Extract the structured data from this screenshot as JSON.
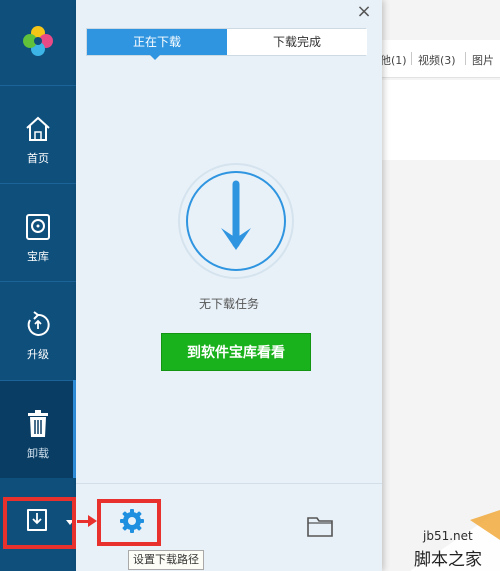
{
  "background_app": {
    "tabs": [
      "他(1)",
      "视频(3)",
      "图片"
    ]
  },
  "sidebar": {
    "items": [
      {
        "label": "首页",
        "icon": "home-icon"
      },
      {
        "label": "宝库",
        "icon": "disk-icon"
      },
      {
        "label": "升级",
        "icon": "upgrade-icon"
      },
      {
        "label": "卸载",
        "icon": "trash-icon"
      }
    ],
    "bottom_icon": "download-icon"
  },
  "panel": {
    "close_glyph": "×",
    "tabs": [
      {
        "label": "正在下载",
        "active": true
      },
      {
        "label": "下载完成",
        "active": false
      }
    ],
    "empty_message": "无下载任务",
    "goto_button": "到软件宝库看看",
    "settings_tooltip": "设置下载路径"
  },
  "watermark": {
    "url": "jb51.net",
    "name": "脚本之家"
  },
  "colors": {
    "sidebar": "#0e4f7c",
    "accent": "#2f95e0",
    "button_green": "#19b11c",
    "highlight_red": "#e8302d"
  }
}
